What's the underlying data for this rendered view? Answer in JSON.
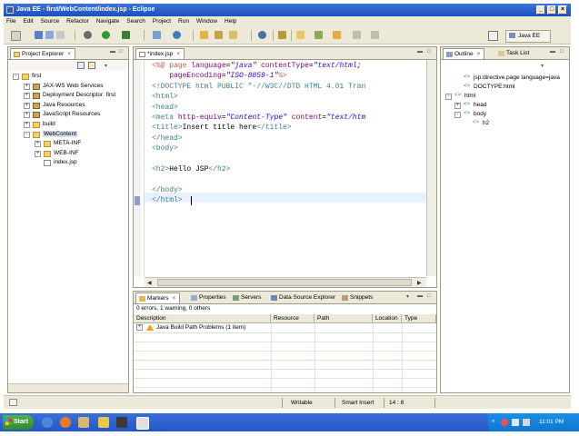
{
  "window": {
    "title": "Java EE - first/WebContent/index.jsp - Eclipse"
  },
  "menu": [
    "File",
    "Edit",
    "Source",
    "Refactor",
    "Navigate",
    "Search",
    "Project",
    "Run",
    "Window",
    "Help"
  ],
  "perspective": {
    "label": "Java EE"
  },
  "project_explorer": {
    "tab_label": "Project Explorer",
    "tree": [
      {
        "label": "first",
        "level": 0,
        "expander": "-",
        "icon": "project-icon"
      },
      {
        "label": "JAX-WS Web Services",
        "level": 1,
        "expander": "+",
        "icon": "webservice-icon"
      },
      {
        "label": "Deployment Descriptor: first",
        "level": 1,
        "expander": "+",
        "icon": "descriptor-icon"
      },
      {
        "label": "Java Resources",
        "level": 1,
        "expander": "+",
        "icon": "java-resources-icon"
      },
      {
        "label": "JavaScript Resources",
        "level": 1,
        "expander": "+",
        "icon": "javascript-resources-icon"
      },
      {
        "label": "build",
        "level": 1,
        "expander": "+",
        "icon": "folder-icon"
      },
      {
        "label": "WebContent",
        "level": 1,
        "expander": "-",
        "icon": "folder-icon",
        "selected": true
      },
      {
        "label": "META-INF",
        "level": 2,
        "expander": "+",
        "icon": "folder-icon"
      },
      {
        "label": "WEB-INF",
        "level": 2,
        "expander": "+",
        "icon": "folder-icon"
      },
      {
        "label": "index.jsp",
        "level": 2,
        "expander": "",
        "icon": "jsp-file-icon"
      }
    ]
  },
  "editor": {
    "tab_label": "*index.jsp",
    "lines": [
      [
        [
          "<%@ page ",
          "jsp"
        ],
        [
          "language",
          "attr"
        ],
        [
          "=",
          "txt"
        ],
        [
          "\"java\"",
          "str"
        ],
        [
          " contentType",
          "attr"
        ],
        [
          "=",
          "txt"
        ],
        [
          "\"text/html;",
          "str"
        ]
      ],
      [
        [
          "    pageEncoding",
          "attr"
        ],
        [
          "=",
          "txt"
        ],
        [
          "\"ISO-8859-1\"",
          "str"
        ],
        [
          "%>",
          "jsp"
        ]
      ],
      [
        [
          "<!DOCTYPE html PUBLIC \"-//W3C//DTD HTML 4.01 Tran",
          "tag"
        ]
      ],
      [
        [
          "<html>",
          "tag"
        ]
      ],
      [
        [
          "<head>",
          "tag"
        ]
      ],
      [
        [
          "<meta ",
          "tag"
        ],
        [
          "http-equiv",
          "attr"
        ],
        [
          "=",
          "txt"
        ],
        [
          "\"Content-Type\"",
          "str"
        ],
        [
          " content",
          "attr"
        ],
        [
          "=",
          "txt"
        ],
        [
          "\"text/htm",
          "str"
        ]
      ],
      [
        [
          "<title>",
          "tag"
        ],
        [
          "Insert title here",
          "txt"
        ],
        [
          "</title>",
          "tag"
        ]
      ],
      [
        [
          "</head>",
          "tag"
        ]
      ],
      [
        [
          "<body>",
          "tag"
        ]
      ],
      [
        [
          "",
          "txt"
        ]
      ],
      [
        [
          "<h2>",
          "tag"
        ],
        [
          "Hello JSP",
          "txt"
        ],
        [
          "</h2>",
          "tag"
        ]
      ],
      [
        [
          "",
          "txt"
        ]
      ],
      [
        [
          "</body>",
          "tag"
        ]
      ],
      [
        [
          "</html>",
          "tag"
        ]
      ]
    ]
  },
  "outline": {
    "tabs": [
      "Outline",
      "Task List"
    ],
    "tree": [
      {
        "label": "jsp:directive.page language=java",
        "level": 1,
        "expander": ""
      },
      {
        "label": "DOCTYPE:html",
        "level": 1,
        "expander": ""
      },
      {
        "label": "html",
        "level": 0,
        "expander": "-"
      },
      {
        "label": "head",
        "level": 1,
        "expander": "+"
      },
      {
        "label": "body",
        "level": 1,
        "expander": "-"
      },
      {
        "label": "h2",
        "level": 2,
        "expander": ""
      }
    ]
  },
  "bottom_panel": {
    "tabs": [
      "Markers",
      "Properties",
      "Servers",
      "Data Source Explorer",
      "Snippets"
    ],
    "summary": "0 errors, 1 warning, 0 others",
    "columns": [
      "Description",
      "Resource",
      "Path",
      "Location",
      "Type"
    ],
    "rows": [
      {
        "description": "Java Build Path Problems (1 item)"
      }
    ]
  },
  "status_bar": {
    "writable": "Writable",
    "insert_mode": "Smart Insert",
    "position": "14 : 8"
  },
  "taskbar": {
    "start": "Start",
    "clock": "11:01 PM"
  }
}
